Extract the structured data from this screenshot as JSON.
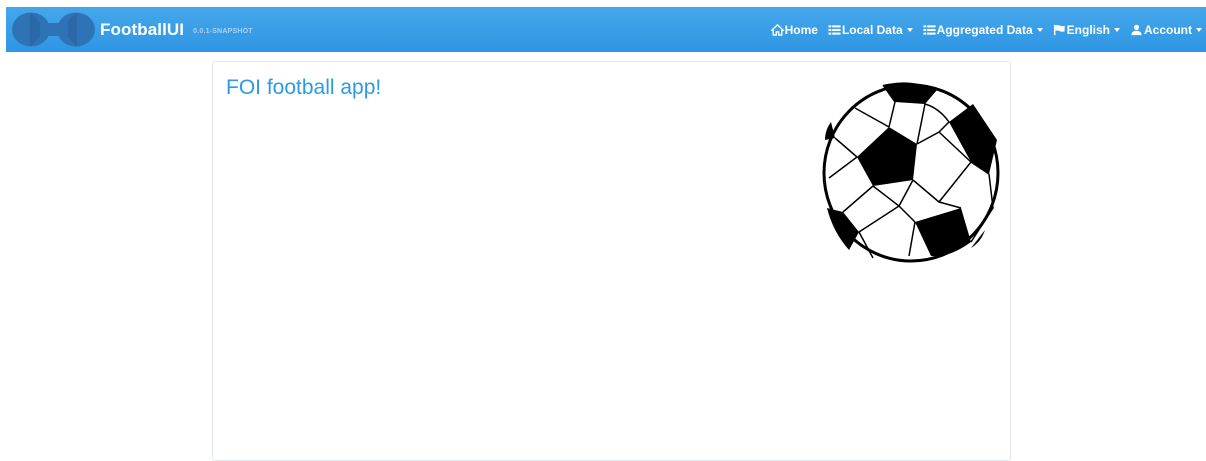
{
  "navbar": {
    "brand_title": "FootballUI",
    "version": "0.0.1-SNAPSHOT",
    "items": [
      {
        "label": "Home",
        "icon": "home-icon",
        "dropdown": false
      },
      {
        "label": "Local Data",
        "icon": "list-icon",
        "dropdown": true
      },
      {
        "label": "Aggregated Data",
        "icon": "list-icon",
        "dropdown": true
      },
      {
        "label": "English",
        "icon": "flag-icon",
        "dropdown": true
      },
      {
        "label": "Account",
        "icon": "user-icon",
        "dropdown": true
      }
    ]
  },
  "main": {
    "title": "FOI football app!"
  },
  "colors": {
    "navbar": "#3a9fe8",
    "title": "#2c9ae6",
    "logo": "#2e6fb0"
  }
}
